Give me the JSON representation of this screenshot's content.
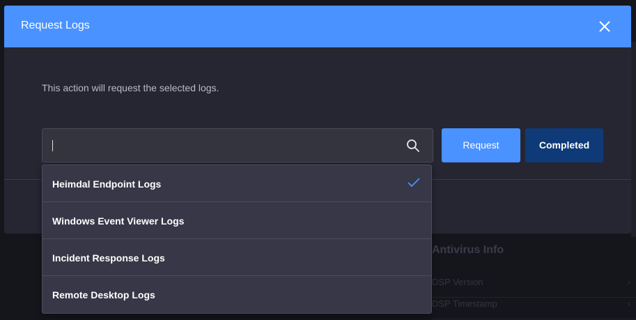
{
  "modal": {
    "title": "Request Logs",
    "description": "This action will request the selected logs.",
    "search": {
      "value": "",
      "placeholder": ""
    },
    "buttons": {
      "request": "Request",
      "completed": "Completed"
    }
  },
  "dropdown": {
    "items": [
      {
        "label": "Heimdal Endpoint Logs",
        "selected": true
      },
      {
        "label": "Windows Event Viewer Logs",
        "selected": false
      },
      {
        "label": "Incident Response Logs",
        "selected": false
      },
      {
        "label": "Remote Desktop Logs",
        "selected": false
      }
    ]
  },
  "background": {
    "section_title": "Antivirus Info",
    "rows": [
      "DSP Version",
      "DSP Timestamp"
    ]
  },
  "colors": {
    "header": "#4a92ff",
    "primary_button": "#4a92ff",
    "secondary_button": "#0f3a78",
    "check": "#4a92ff"
  },
  "icons": [
    "close-icon",
    "search-icon",
    "check-icon"
  ]
}
